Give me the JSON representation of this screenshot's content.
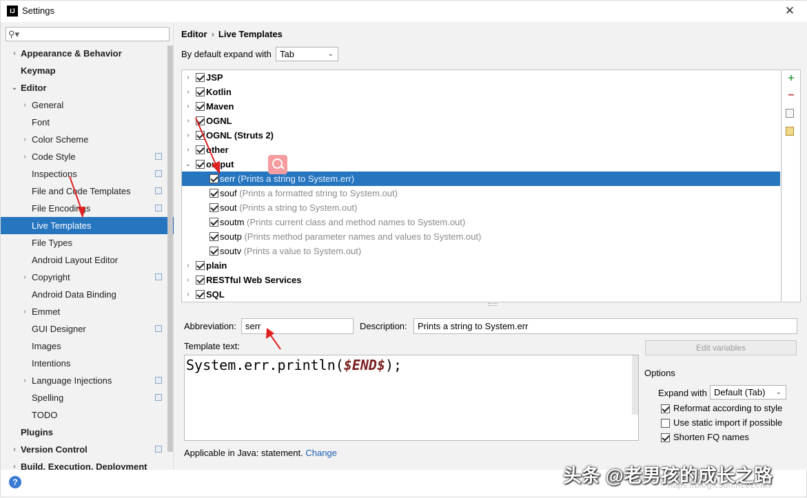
{
  "window": {
    "title": "Settings",
    "app_icon": "IJ"
  },
  "search": {
    "placeholder": "",
    "icon": "search-icon"
  },
  "sidebar": {
    "items": [
      {
        "label": "Appearance & Behavior",
        "level": 0,
        "bold": true,
        "arrow": "›",
        "proj": false
      },
      {
        "label": "Keymap",
        "level": 0,
        "bold": true,
        "arrow": "",
        "proj": false
      },
      {
        "label": "Editor",
        "level": 0,
        "bold": true,
        "arrow": "⌄",
        "proj": false
      },
      {
        "label": "General",
        "level": 1,
        "bold": false,
        "arrow": "›",
        "proj": false
      },
      {
        "label": "Font",
        "level": 1,
        "bold": false,
        "arrow": "",
        "proj": false
      },
      {
        "label": "Color Scheme",
        "level": 1,
        "bold": false,
        "arrow": "›",
        "proj": false
      },
      {
        "label": "Code Style",
        "level": 1,
        "bold": false,
        "arrow": "›",
        "proj": true
      },
      {
        "label": "Inspections",
        "level": 1,
        "bold": false,
        "arrow": "",
        "proj": true
      },
      {
        "label": "File and Code Templates",
        "level": 1,
        "bold": false,
        "arrow": "",
        "proj": true
      },
      {
        "label": "File Encodings",
        "level": 1,
        "bold": false,
        "arrow": "",
        "proj": true
      },
      {
        "label": "Live Templates",
        "level": 1,
        "bold": false,
        "arrow": "",
        "proj": false,
        "selected": true
      },
      {
        "label": "File Types",
        "level": 1,
        "bold": false,
        "arrow": "",
        "proj": false
      },
      {
        "label": "Android Layout Editor",
        "level": 1,
        "bold": false,
        "arrow": "",
        "proj": false
      },
      {
        "label": "Copyright",
        "level": 1,
        "bold": false,
        "arrow": "›",
        "proj": true
      },
      {
        "label": "Android Data Binding",
        "level": 1,
        "bold": false,
        "arrow": "",
        "proj": false
      },
      {
        "label": "Emmet",
        "level": 1,
        "bold": false,
        "arrow": "›",
        "proj": false
      },
      {
        "label": "GUI Designer",
        "level": 1,
        "bold": false,
        "arrow": "",
        "proj": true
      },
      {
        "label": "Images",
        "level": 1,
        "bold": false,
        "arrow": "",
        "proj": false
      },
      {
        "label": "Intentions",
        "level": 1,
        "bold": false,
        "arrow": "",
        "proj": false
      },
      {
        "label": "Language Injections",
        "level": 1,
        "bold": false,
        "arrow": "›",
        "proj": true
      },
      {
        "label": "Spelling",
        "level": 1,
        "bold": false,
        "arrow": "",
        "proj": true
      },
      {
        "label": "TODO",
        "level": 1,
        "bold": false,
        "arrow": "",
        "proj": false
      },
      {
        "label": "Plugins",
        "level": 0,
        "bold": true,
        "arrow": "",
        "proj": false
      },
      {
        "label": "Version Control",
        "level": 0,
        "bold": true,
        "arrow": "›",
        "proj": true
      },
      {
        "label": "Build, Execution, Deployment",
        "level": 0,
        "bold": true,
        "arrow": "›",
        "proj": false
      }
    ]
  },
  "breadcrumb": {
    "parent": "Editor",
    "separator": "›",
    "current": "Live Templates"
  },
  "expand": {
    "label": "By default expand with",
    "value": "Tab"
  },
  "templates": [
    {
      "group": true,
      "expanded": false,
      "checked": true,
      "name": "JSP",
      "desc": ""
    },
    {
      "group": true,
      "expanded": false,
      "checked": true,
      "name": "Kotlin",
      "desc": ""
    },
    {
      "group": true,
      "expanded": false,
      "checked": true,
      "name": "Maven",
      "desc": ""
    },
    {
      "group": true,
      "expanded": false,
      "checked": true,
      "name": "OGNL",
      "desc": ""
    },
    {
      "group": true,
      "expanded": false,
      "checked": true,
      "name": "OGNL (Struts 2)",
      "desc": ""
    },
    {
      "group": true,
      "expanded": false,
      "checked": true,
      "name": "other",
      "desc": ""
    },
    {
      "group": true,
      "expanded": true,
      "checked": true,
      "name": "output",
      "desc": ""
    },
    {
      "group": false,
      "checked": true,
      "name": "serr",
      "desc": "(Prints a string to System.err)",
      "selected": true
    },
    {
      "group": false,
      "checked": true,
      "name": "souf",
      "desc": "(Prints a formatted string to System.out)"
    },
    {
      "group": false,
      "checked": true,
      "name": "sout",
      "desc": "(Prints a string to System.out)"
    },
    {
      "group": false,
      "checked": true,
      "name": "soutm",
      "desc": "(Prints current class and method names to System.out)"
    },
    {
      "group": false,
      "checked": true,
      "name": "soutp",
      "desc": "(Prints method parameter names and values to System.out)"
    },
    {
      "group": false,
      "checked": true,
      "name": "soutv",
      "desc": "(Prints a value to System.out)"
    },
    {
      "group": true,
      "expanded": false,
      "checked": true,
      "name": "plain",
      "desc": ""
    },
    {
      "group": true,
      "expanded": false,
      "checked": true,
      "name": "RESTful Web Services",
      "desc": ""
    },
    {
      "group": true,
      "expanded": false,
      "checked": true,
      "name": "SQL",
      "desc": ""
    }
  ],
  "tools": {
    "add": "+",
    "remove": "−",
    "copy_icon": "copy-icon",
    "edit_icon": "edit-icon"
  },
  "abbreviation": {
    "label": "Abbreviation:",
    "value": "serr"
  },
  "description": {
    "label": "Description:",
    "value": "Prints a string to System.err"
  },
  "template_text": {
    "label": "Template text:",
    "code_prefix": "System.err.println(",
    "code_var": "$END$",
    "code_suffix": ");"
  },
  "edit_variables": {
    "label": "Edit variables"
  },
  "options": {
    "title": "Options",
    "expand_label": "Expand with",
    "expand_value": "Default (Tab)",
    "reformat": {
      "label": "Reformat according to style",
      "checked": true
    },
    "static_import": {
      "label": "Use static import if possible",
      "checked": false
    },
    "shorten_fq": {
      "label": "Shorten FQ names",
      "checked": true
    }
  },
  "applicable": {
    "text": "Applicable in Java: statement.",
    "link": "Change"
  },
  "watermark": {
    "text": "头条 @老男孩的成长之路",
    "url": "https://blog.csdn.net/zeals"
  },
  "colors": {
    "selection": "#2675bf",
    "panel": "#f2f2f2",
    "annotation_arrow": "#e02020"
  }
}
